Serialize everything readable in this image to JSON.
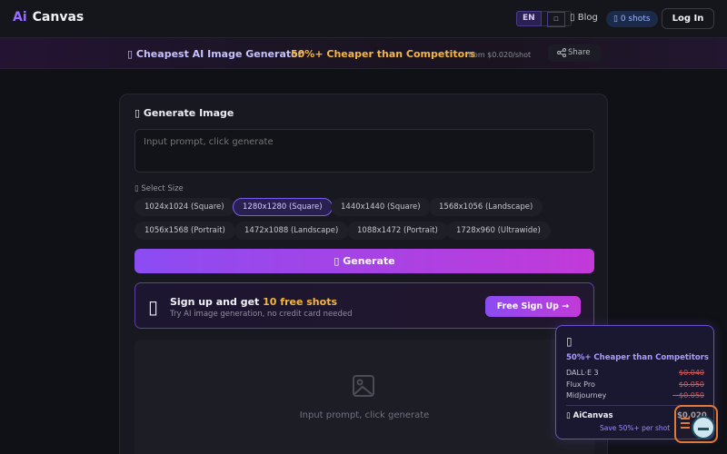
{
  "header": {
    "logo_ai": "Ai",
    "logo_canvas": "Canvas",
    "lang_active": "EN",
    "lang_other": "",
    "blog_label": "Blog",
    "shots_label": "0 shots",
    "login_label": "Log In"
  },
  "promo": {
    "title": "Cheapest AI Image Generator",
    "highlight": "50%+ Cheaper than Competitors",
    "price_note": "from $0.020/shot",
    "share_label": "Share"
  },
  "generator": {
    "title": "Generate Image",
    "prompt_placeholder": "Input prompt, click generate",
    "size_label": "Select Size",
    "sizes": [
      "1024x1024 (Square)",
      "1280x1280 (Square)",
      "1440x1440 (Square)",
      "1568x1056 (Landscape)",
      "1056x1568 (Portrait)",
      "1472x1088 (Landscape)",
      "1088x1472 (Portrait)",
      "1728x960 (Ultrawide)"
    ],
    "selected_size": "1280x1280 (Square)",
    "generate_label": "Generate"
  },
  "signup": {
    "title_prefix": "Sign up and get",
    "title_highlight": "10 free shots",
    "subtitle": "Try AI image generation, no credit card needed",
    "button_label": "Free Sign Up →"
  },
  "preview": {
    "placeholder": "Input prompt, click generate"
  },
  "compare": {
    "heading": "50%+ Cheaper than Competitors",
    "competitors": [
      {
        "name": "DALL·E 3",
        "price": "$0.040"
      },
      {
        "name": "Flux Pro",
        "price": "$0.050"
      },
      {
        "name": "Midjourney",
        "price": "~$0.050"
      }
    ],
    "ours_name": "AiCanvas",
    "ours_price": "$0.020",
    "save_note": "Save 50%+ per shot"
  },
  "colors": {
    "accent": "#8b4cf2",
    "accent2": "#c23ad8",
    "highlight": "#f5b641",
    "background": "#101116"
  }
}
